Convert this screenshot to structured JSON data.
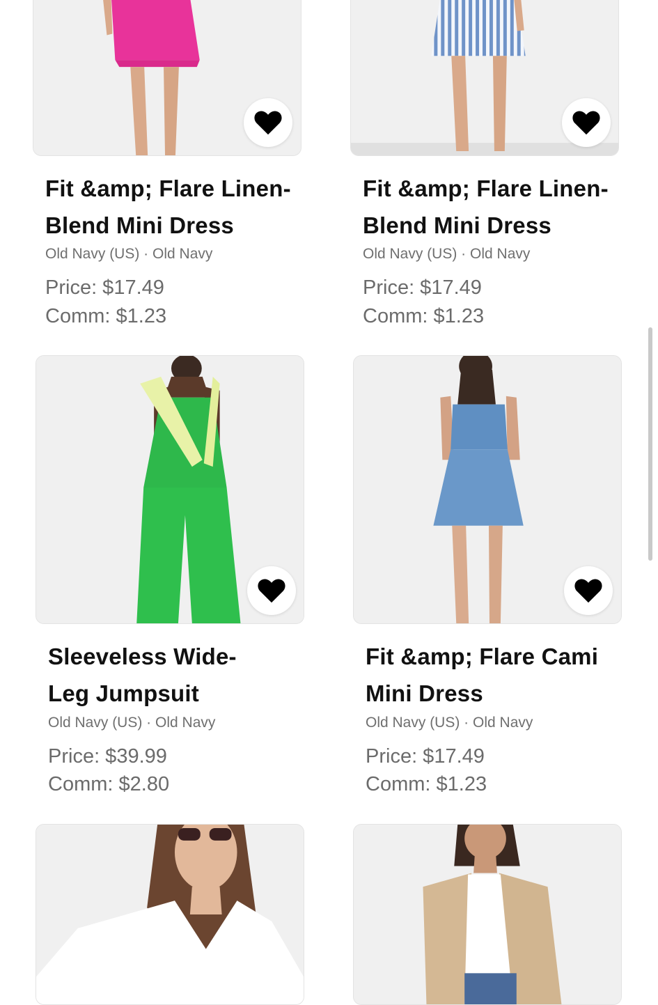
{
  "products": [
    {
      "title_line1": "Fit &amp; Flare Linen-",
      "title_line2": "Blend Mini Dress",
      "merchant": "Old Navy (US) · Old Navy",
      "price": "Price: $17.49",
      "comm": "Comm: $1.23",
      "favorite_icon": "heart-icon",
      "image": "pink-mini-dress"
    },
    {
      "title_line1": "Fit &amp; Flare Linen-",
      "title_line2": "Blend Mini Dress",
      "merchant": "Old Navy (US) · Old Navy",
      "price": "Price: $17.49",
      "comm": "Comm: $1.23",
      "favorite_icon": "heart-icon",
      "image": "blue-striped-mini-dress"
    },
    {
      "title_line1": "Sleeveless Wide-",
      "title_line2": "Leg Jumpsuit",
      "merchant": "Old Navy (US) · Old Navy",
      "price": "Price: $39.99",
      "comm": "Comm: $2.80",
      "favorite_icon": "heart-icon",
      "image": "green-jumpsuit"
    },
    {
      "title_line1": "Fit &amp; Flare Cami",
      "title_line2": "Mini Dress",
      "merchant": "Old Navy (US) · Old Navy",
      "price": "Price: $17.49",
      "comm": "Comm: $1.23",
      "favorite_icon": "heart-icon",
      "image": "denim-cami-dress"
    },
    {
      "image": "white-v-neck-tee"
    },
    {
      "image": "tan-cardigan"
    }
  ],
  "colors": {
    "heart": "#000000",
    "text": "#111111",
    "muted": "#6b6b6b"
  }
}
